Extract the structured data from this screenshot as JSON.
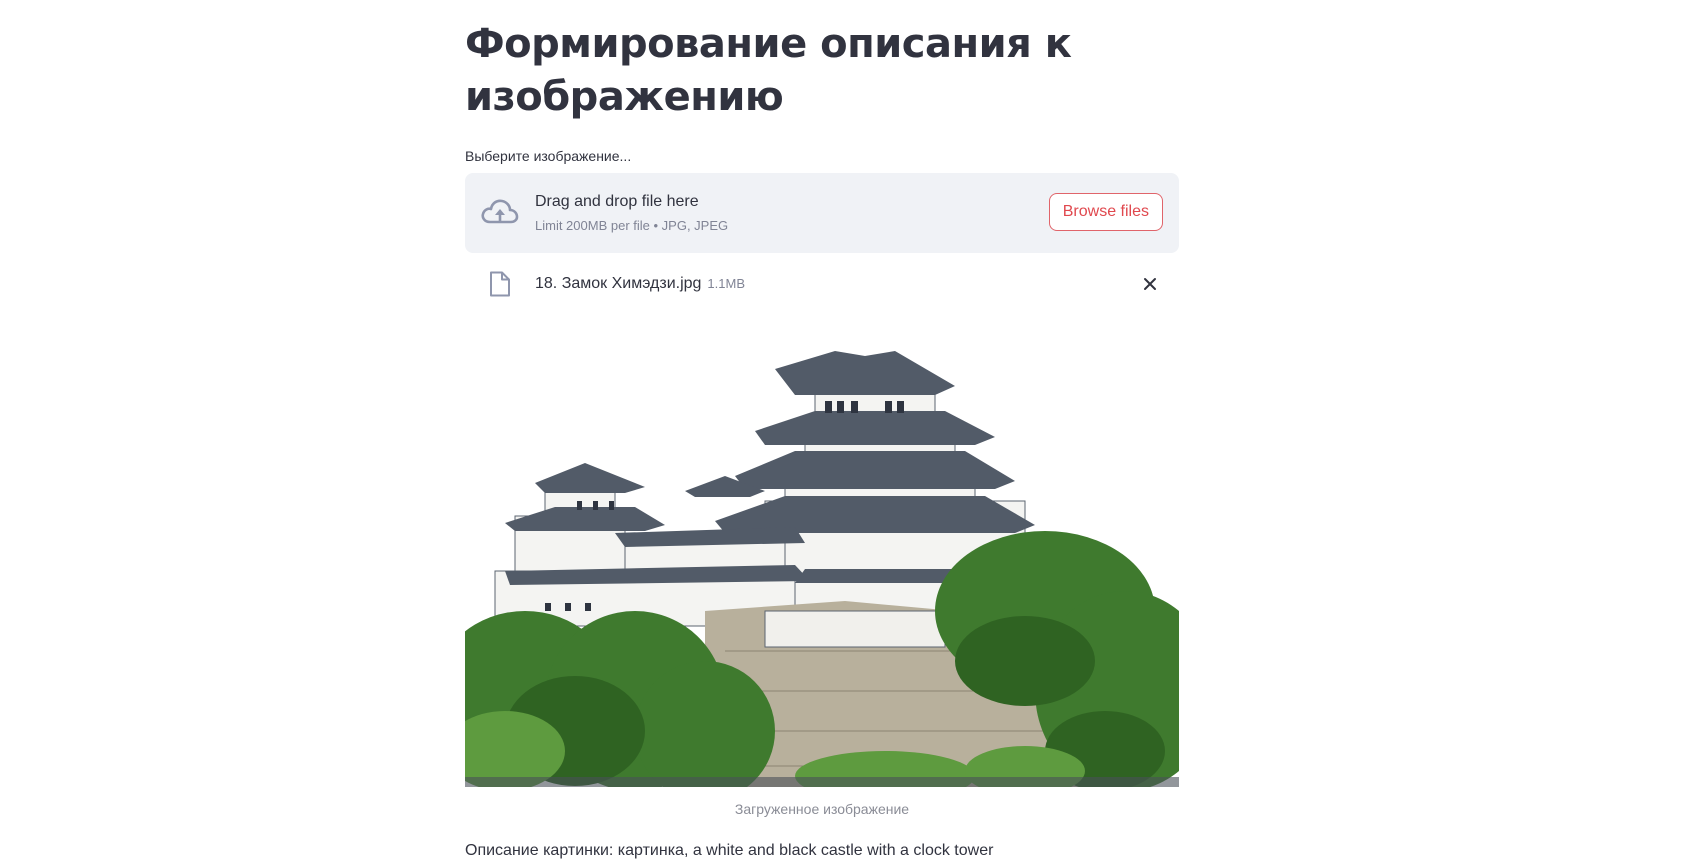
{
  "page": {
    "title": "Формирование описания к изображению"
  },
  "uploader": {
    "label": "Выберите изображение...",
    "instruction": "Drag and drop file here",
    "limit": "Limit 200MB per file • JPG, JPEG",
    "browse_label": "Browse files",
    "icon": "cloud-upload-icon"
  },
  "file": {
    "name": "18. Замок Химэдзи.jpg",
    "size": "1.1MB",
    "icon": "file-icon",
    "remove_icon": "close-icon"
  },
  "image": {
    "caption": "Загруженное изображение"
  },
  "result": {
    "description": "Описание картинки: картинка, a white and black castle with a clock tower"
  },
  "colors": {
    "accent": "#ff4b4b",
    "text": "#31333f",
    "muted": "#808495",
    "dropzone_bg": "#f0f2f6"
  }
}
